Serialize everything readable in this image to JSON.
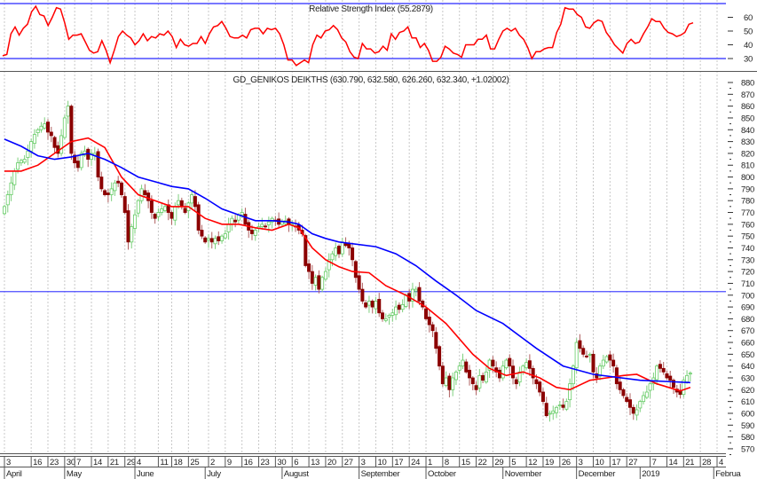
{
  "chart_data": [
    {
      "type": "line",
      "title": "Relative Strength Index (55.2879)",
      "ylim": [
        20,
        75
      ],
      "yticks": [
        60,
        50,
        40,
        30
      ],
      "reference_lines": [
        70,
        30
      ],
      "series": [
        {
          "name": "RSI",
          "color": "#ff0000",
          "values": [
            32,
            33,
            48,
            53,
            47,
            52,
            55,
            64,
            68,
            62,
            61,
            54,
            60,
            67,
            66,
            56,
            44,
            47,
            47,
            48,
            42,
            36,
            34,
            35,
            43,
            36,
            27,
            36,
            46,
            50,
            47,
            45,
            40,
            43,
            48,
            43,
            46,
            45,
            48,
            47,
            50,
            46,
            38,
            44,
            40,
            39,
            41,
            41,
            46,
            41,
            48,
            53,
            54,
            57,
            52,
            46,
            45,
            45,
            47,
            45,
            51,
            52,
            52,
            48,
            52,
            51,
            52,
            48,
            40,
            29,
            29,
            25,
            27,
            29,
            27,
            40,
            47,
            45,
            50,
            51,
            54,
            51,
            45,
            42,
            35,
            31,
            30,
            41,
            37,
            37,
            34,
            35,
            39,
            36,
            48,
            44,
            49,
            50,
            53,
            45,
            45,
            38,
            41,
            36,
            28,
            28,
            31,
            39,
            37,
            34,
            33,
            31,
            40,
            40,
            40,
            44,
            44,
            47,
            37,
            37,
            44,
            50,
            52,
            50,
            52,
            47,
            44,
            38,
            30,
            35,
            35,
            37,
            38,
            38,
            49,
            55,
            67,
            66,
            66,
            62,
            60,
            53,
            52,
            56,
            58,
            57,
            49,
            45,
            40,
            37,
            34,
            41,
            44,
            41,
            42,
            48,
            53,
            59,
            57,
            57,
            52,
            49,
            48,
            46,
            47,
            49,
            55,
            56
          ]
        }
      ]
    },
    {
      "type": "candlestick",
      "title": "GD_GENIKOS DEIKTHS (630.790, 632.580, 626.260, 632.340, +1.02002)",
      "ylim": [
        565,
        885
      ],
      "yticks": [
        880,
        870,
        860,
        850,
        840,
        830,
        820,
        810,
        800,
        790,
        780,
        770,
        760,
        750,
        740,
        730,
        720,
        710,
        700,
        690,
        680,
        670,
        660,
        650,
        640,
        630,
        620,
        610,
        600,
        590,
        580,
        570
      ],
      "horizontal_line": 703,
      "up_color": "#66cc66",
      "down_color": "#8b0000",
      "closes": [
        775,
        785,
        795,
        805,
        812,
        814,
        815,
        822,
        830,
        836,
        840,
        843,
        845,
        838,
        835,
        825,
        820,
        835,
        850,
        860,
        820,
        812,
        808,
        820,
        822,
        815,
        820,
        820,
        800,
        790,
        785,
        785,
        790,
        795,
        795,
        785,
        770,
        745,
        758,
        768,
        780,
        790,
        785,
        780,
        770,
        765,
        770,
        773,
        775,
        770,
        765,
        775,
        780,
        775,
        770,
        778,
        785,
        775,
        755,
        750,
        745,
        748,
        745,
        748,
        746,
        750,
        752,
        760,
        765,
        762,
        768,
        770,
        760,
        755,
        752,
        755,
        758,
        760,
        758,
        762,
        765,
        763,
        760,
        762,
        763,
        760,
        760,
        758,
        755,
        752,
        725,
        720,
        710,
        715,
        705,
        715,
        720,
        730,
        735,
        740,
        735,
        745,
        742,
        740,
        730,
        715,
        705,
        695,
        690,
        695,
        690,
        695,
        685,
        680,
        680,
        683,
        685,
        690,
        688,
        692,
        700,
        695,
        705,
        705,
        695,
        690,
        680,
        675,
        670,
        655,
        640,
        625,
        630,
        620,
        630,
        635,
        640,
        645,
        635,
        630,
        625,
        620,
        632,
        628,
        635,
        645,
        640,
        635,
        630,
        640,
        645,
        640,
        630,
        625,
        635,
        640,
        643,
        638,
        630,
        625,
        618,
        610,
        598,
        600,
        602,
        605,
        607,
        605,
        610,
        625,
        640,
        660,
        655,
        650,
        648,
        650,
        635,
        630,
        640,
        645,
        648,
        645,
        640,
        625,
        620,
        615,
        610,
        605,
        600,
        603,
        610,
        615,
        618,
        625,
        630,
        640,
        638,
        635,
        630,
        628,
        622,
        618,
        616,
        628,
        632,
        634
      ],
      "moving_averages": [
        {
          "name": "short MA",
          "color": "#ff0000",
          "points": [
            [
              0,
              805
            ],
            [
              5,
              805
            ],
            [
              10,
              810
            ],
            [
              15,
              820
            ],
            [
              20,
              830
            ],
            [
              25,
              833
            ],
            [
              30,
              825
            ],
            [
              35,
              800
            ],
            [
              40,
              785
            ],
            [
              45,
              780
            ],
            [
              50,
              775
            ],
            [
              55,
              775
            ],
            [
              60,
              765
            ],
            [
              65,
              760
            ],
            [
              70,
              760
            ],
            [
              75,
              757
            ],
            [
              80,
              755
            ],
            [
              85,
              760
            ],
            [
              88,
              757
            ],
            [
              92,
              740
            ],
            [
              96,
              730
            ],
            [
              100,
              724
            ],
            [
              104,
              720
            ],
            [
              109,
              719
            ],
            [
              114,
              708
            ],
            [
              120,
              700
            ],
            [
              126,
              690
            ],
            [
              132,
              676
            ],
            [
              140,
              650
            ],
            [
              145,
              638
            ],
            [
              150,
              632
            ],
            [
              155,
              635
            ],
            [
              160,
              630
            ],
            [
              165,
              622
            ],
            [
              169,
              620
            ],
            [
              175,
              628
            ],
            [
              180,
              630
            ],
            [
              185,
              632
            ],
            [
              189,
              633
            ],
            [
              195,
              625
            ],
            [
              202,
              619
            ],
            [
              205,
              622
            ]
          ]
        },
        {
          "name": "long MA",
          "color": "#0000ff",
          "points": [
            [
              0,
              832
            ],
            [
              5,
              826
            ],
            [
              10,
              818
            ],
            [
              15,
              815
            ],
            [
              20,
              817
            ],
            [
              25,
              820
            ],
            [
              30,
              815
            ],
            [
              35,
              808
            ],
            [
              40,
              800
            ],
            [
              45,
              796
            ],
            [
              50,
              792
            ],
            [
              55,
              790
            ],
            [
              60,
              782
            ],
            [
              65,
              773
            ],
            [
              70,
              768
            ],
            [
              75,
              763
            ],
            [
              80,
              763
            ],
            [
              85,
              762
            ],
            [
              88,
              760
            ],
            [
              92,
              752
            ],
            [
              96,
              748
            ],
            [
              100,
              745
            ],
            [
              111,
              741
            ],
            [
              117,
              735
            ],
            [
              123,
              725
            ],
            [
              129,
              712
            ],
            [
              135,
              700
            ],
            [
              141,
              687
            ],
            [
              149,
              676
            ],
            [
              159,
              655
            ],
            [
              167,
              640
            ],
            [
              176,
              633
            ],
            [
              190,
              628
            ],
            [
              205,
              626
            ]
          ]
        }
      ]
    }
  ],
  "x_axis": {
    "day_labels": [
      {
        "label": "3",
        "day": 0
      },
      {
        "label": "16",
        "day": 8
      },
      {
        "label": "23",
        "day": 13
      },
      {
        "label": "30",
        "day": 18
      },
      {
        "label": "7",
        "day": 21
      },
      {
        "label": "14",
        "day": 26
      },
      {
        "label": "21",
        "day": 31
      },
      {
        "label": "29",
        "day": 36
      },
      {
        "label": "4",
        "day": 39
      },
      {
        "label": "11",
        "day": 46
      },
      {
        "label": "18",
        "day": 50
      },
      {
        "label": "25",
        "day": 55
      },
      {
        "label": "2",
        "day": 61
      },
      {
        "label": "9",
        "day": 66
      },
      {
        "label": "16",
        "day": 71
      },
      {
        "label": "23",
        "day": 76
      },
      {
        "label": "30",
        "day": 81
      },
      {
        "label": "6",
        "day": 86
      },
      {
        "label": "13",
        "day": 91
      },
      {
        "label": "20",
        "day": 96
      },
      {
        "label": "27",
        "day": 101
      },
      {
        "label": "3",
        "day": 106
      },
      {
        "label": "10",
        "day": 111
      },
      {
        "label": "17",
        "day": 116
      },
      {
        "label": "24",
        "day": 121
      },
      {
        "label": "1",
        "day": 126
      },
      {
        "label": "8",
        "day": 131
      },
      {
        "label": "15",
        "day": 136
      },
      {
        "label": "22",
        "day": 141
      },
      {
        "label": "29",
        "day": 146
      },
      {
        "label": "5",
        "day": 151
      },
      {
        "label": "12",
        "day": 156
      },
      {
        "label": "19",
        "day": 161
      },
      {
        "label": "26",
        "day": 166
      },
      {
        "label": "3",
        "day": 171
      },
      {
        "label": "10",
        "day": 176
      },
      {
        "label": "17",
        "day": 181
      },
      {
        "label": "27",
        "day": 186
      },
      {
        "label": "7",
        "day": 193
      },
      {
        "label": "14",
        "day": 198
      },
      {
        "label": "21",
        "day": 203
      },
      {
        "label": "28",
        "day": 208
      },
      {
        "label": "4",
        "day": 213
      }
    ],
    "month_labels": [
      {
        "label": "April",
        "day": 0
      },
      {
        "label": "May",
        "day": 18
      },
      {
        "label": "June",
        "day": 39
      },
      {
        "label": "July",
        "day": 60
      },
      {
        "label": "August",
        "day": 83
      },
      {
        "label": "September",
        "day": 106
      },
      {
        "label": "October",
        "day": 126
      },
      {
        "label": "November",
        "day": 149
      },
      {
        "label": "December",
        "day": 171
      },
      {
        "label": "2019",
        "day": 190
      },
      {
        "label": "Februa",
        "day": 212
      }
    ]
  }
}
